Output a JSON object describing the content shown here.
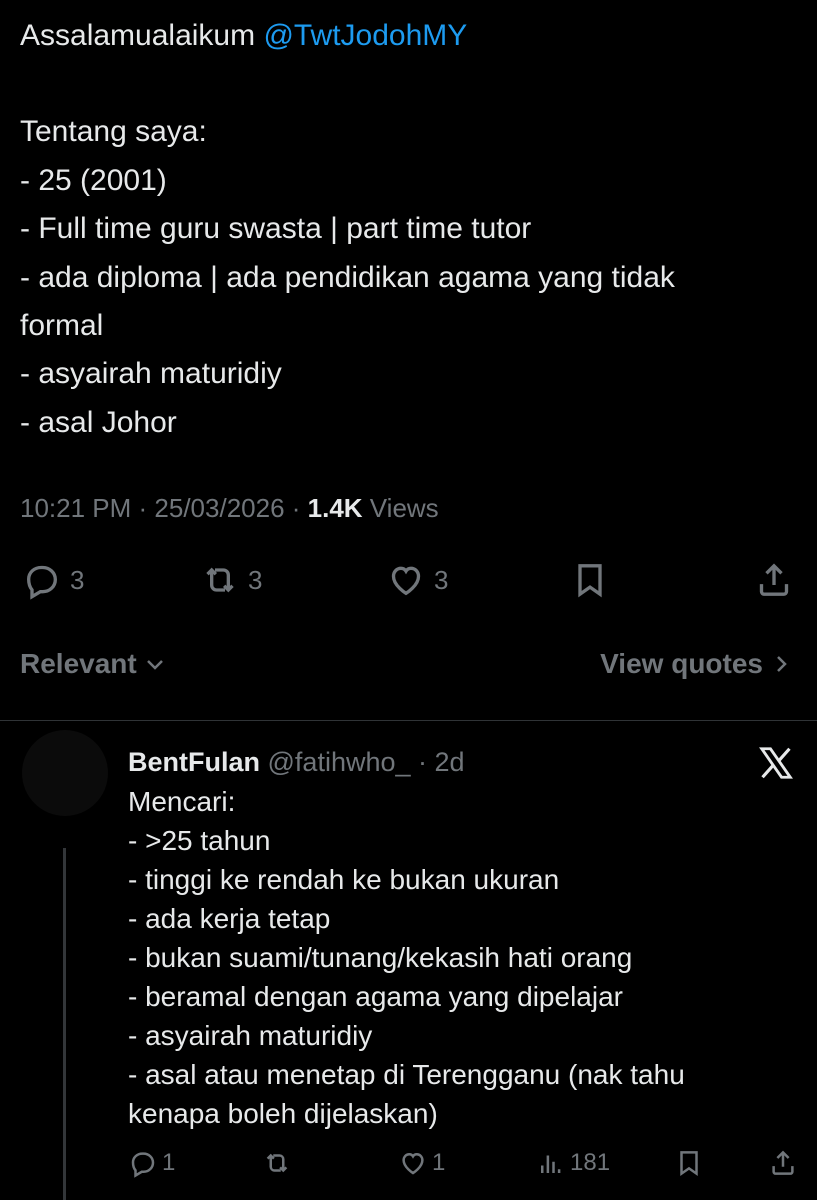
{
  "tweet": {
    "greeting": "Assalamualaikum ",
    "mention": "@TwtJodohMY",
    "lines": [
      "Tentang saya:",
      "- 25 (2001)",
      "- Full time guru swasta | part time tutor",
      "- ada diploma | ada pendidikan agama yang tidak",
      "formal",
      "- asyairah maturidiy",
      "- asal Johor"
    ],
    "time": "10:21 PM",
    "separator": " · ",
    "date": "25/03/2026",
    "views_count": "1.4K",
    "views_label": " Views",
    "actions": {
      "replies": "3",
      "reposts": "3",
      "likes": "3"
    }
  },
  "sort": {
    "label": "Relevant",
    "quotes_label": "View quotes"
  },
  "reply": {
    "name": "BentFulan",
    "handle": "@fatihwho_",
    "separator": " · ",
    "time": "2d",
    "lines": [
      "Mencari:",
      "- >25 tahun",
      "- tinggi ke rendah ke bukan ukuran",
      "- ada kerja tetap",
      "- bukan suami/tunang/kekasih hati orang",
      "- beramal dengan agama yang dipelajar",
      "- asyairah maturidiy",
      "- asal atau menetap di Terengganu (nak tahu",
      "kenapa boleh dijelaskan)"
    ],
    "actions": {
      "replies": "1",
      "likes": "1",
      "views": "181"
    }
  },
  "colors": {
    "background": "#000000",
    "text": "#e7e9ea",
    "muted": "#71767b",
    "link": "#1d9bf0",
    "divider": "#2f3336"
  },
  "icons": [
    "reply-icon",
    "repost-icon",
    "like-icon",
    "bookmark-icon",
    "share-icon",
    "chevron-down-icon",
    "chevron-right-icon",
    "x-logo-icon",
    "views-icon"
  ]
}
